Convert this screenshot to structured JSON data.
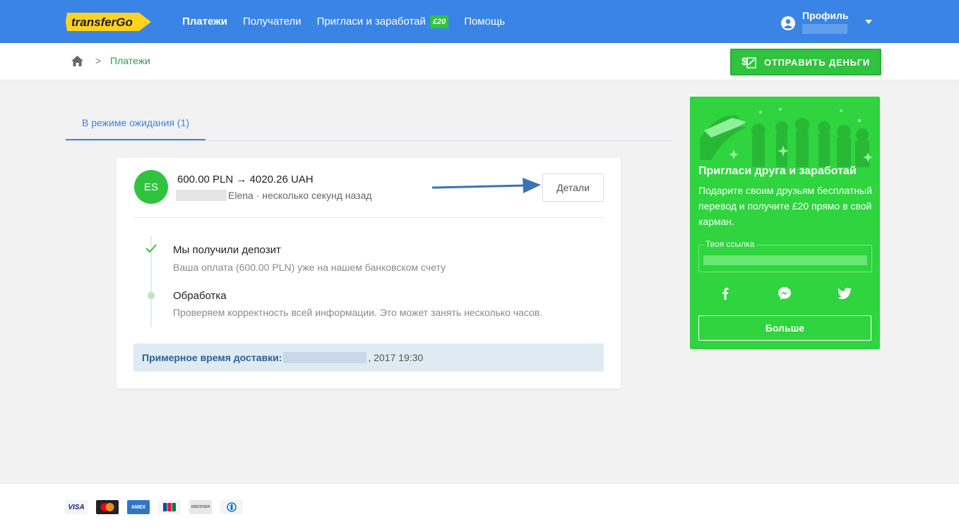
{
  "header": {
    "logo_text": "transferGo",
    "nav": [
      {
        "label": "Платежи"
      },
      {
        "label": "Получатели"
      },
      {
        "label": "Пригласи и заработай"
      },
      {
        "label": "Помощь"
      }
    ],
    "invite_badge": "£20",
    "profile_label": "Профиль"
  },
  "subheader": {
    "breadcrumb_sep": ">",
    "breadcrumb_current": "Платежи",
    "send_button": "ОТПРАВИТЬ ДЕНЬГИ"
  },
  "tabs": {
    "pending": "В режиме ожидания (1)"
  },
  "transfer": {
    "avatar_initials": "ES",
    "amount": "600.00 PLN  →  4020.26 UAH",
    "recipient_suffix": "Elena · несколько секунд назад",
    "details_button": "Детали",
    "steps": [
      {
        "title": "Мы получили депозит",
        "desc": "Ваша оплата (600.00 PLN) уже на нашем банковском счету"
      },
      {
        "title": "Обработка",
        "desc": "Проверяем корректность всей информации. Это может занять несколько часов."
      }
    ],
    "delivery_label": "Примерное время доставки:",
    "delivery_value": ", 2017 19:30"
  },
  "invite": {
    "title": "Пригласи друга и заработай",
    "text": "Подарите своим друзьям бесплатный перевод и получите £20 прямо в свой карман.",
    "link_label": "Твоя ссылка",
    "more_button": "Больше"
  },
  "footer": {
    "cards": [
      "VISA",
      "Mastercard",
      "AMEX",
      "JCB",
      "DISCOVER",
      "Diners"
    ]
  },
  "colors": {
    "primary_blue": "#3a84e6",
    "brand_green": "#2fc33e",
    "logo_yellow": "#ffd21f"
  }
}
